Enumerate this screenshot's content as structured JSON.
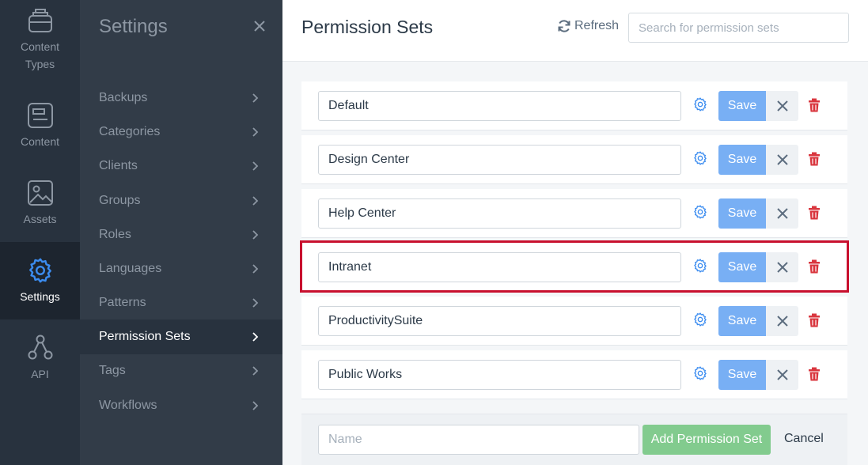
{
  "rail": {
    "items": [
      {
        "label_1": "Content",
        "label_2": "Types",
        "icon": "content-types-icon"
      },
      {
        "label": "Content",
        "icon": "content-icon"
      },
      {
        "label": "Assets",
        "icon": "image-icon"
      },
      {
        "label": "Settings",
        "icon": "gear-icon",
        "active": true
      },
      {
        "label": "API",
        "icon": "api-icon"
      }
    ]
  },
  "settings": {
    "title": "Settings",
    "menu": [
      {
        "label": "Backups"
      },
      {
        "label": "Categories"
      },
      {
        "label": "Clients"
      },
      {
        "label": "Groups"
      },
      {
        "label": "Roles"
      },
      {
        "label": "Languages"
      },
      {
        "label": "Patterns"
      },
      {
        "label": "Permission Sets",
        "active": true
      },
      {
        "label": "Tags"
      },
      {
        "label": "Workflows"
      }
    ]
  },
  "header": {
    "title": "Permission Sets",
    "refresh_label": "Refresh",
    "search_placeholder": "Search for permission sets"
  },
  "permission_sets": [
    {
      "name": "Default"
    },
    {
      "name": "Design Center"
    },
    {
      "name": "Help Center"
    },
    {
      "name": "Intranet",
      "highlighted": true
    },
    {
      "name": "ProductivitySuite"
    },
    {
      "name": "Public Works"
    }
  ],
  "row_actions": {
    "save_label": "Save"
  },
  "add_form": {
    "name_placeholder": "Name",
    "add_label": "Add Permission Set",
    "cancel_label": "Cancel"
  },
  "colors": {
    "rail_bg": "#28323e",
    "panel_bg": "#323c48",
    "accent_blue": "#3b8cf0",
    "save_button": "#78aff4",
    "add_button": "#82cb8e",
    "delete_red": "#d9363e",
    "highlight_border": "#c8102e"
  }
}
